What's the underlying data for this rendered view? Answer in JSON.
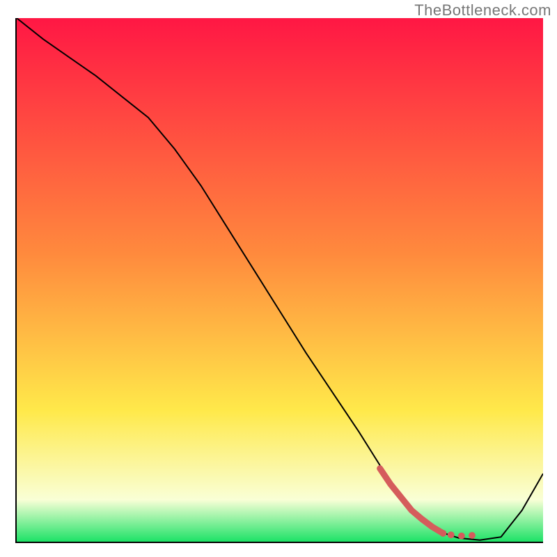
{
  "watermark": "TheBottleneck.com",
  "colors": {
    "gradient_top": "#ff1744",
    "gradient_mid_orange": "#ff8a3d",
    "gradient_mid_yellow": "#ffe94a",
    "gradient_pale": "#f9ffd6",
    "gradient_bottom": "#1de267",
    "curve_stroke": "#000000",
    "marker_stroke": "#d55c5c"
  },
  "chart_data": {
    "type": "line",
    "title": "",
    "xlabel": "",
    "ylabel": "",
    "xlim": [
      0,
      100
    ],
    "ylim": [
      0,
      100
    ],
    "series": [
      {
        "name": "curve",
        "x": [
          0,
          5,
          10,
          15,
          20,
          25,
          30,
          35,
          40,
          45,
          50,
          55,
          60,
          65,
          70,
          73,
          76,
          80,
          84,
          88,
          92,
          96,
          100
        ],
        "values": [
          100,
          96,
          92.5,
          89,
          85,
          81,
          75,
          68,
          60,
          52,
          44,
          36,
          28.5,
          21,
          13,
          8.5,
          5,
          2,
          0.7,
          0.3,
          0.9,
          6,
          13
        ]
      },
      {
        "name": "highlight",
        "x": [
          69,
          71,
          73,
          75,
          77,
          79,
          81,
          82.5,
          84.5,
          86.5
        ],
        "values": [
          14,
          11,
          8.5,
          6,
          4.3,
          2.8,
          1.6,
          1.3,
          1.1,
          1.2
        ]
      }
    ],
    "annotations": []
  }
}
